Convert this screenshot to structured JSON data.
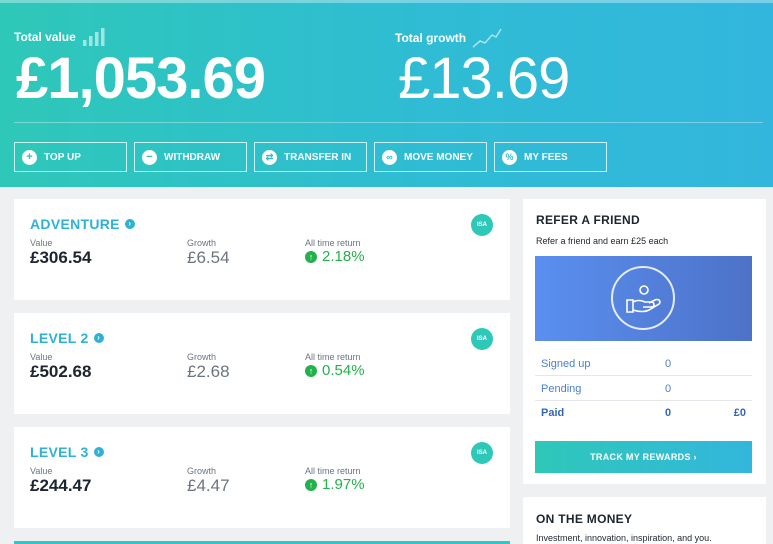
{
  "header": {
    "total_value_label": "Total value",
    "total_value": "£1,053.69",
    "total_growth_label": "Total growth",
    "total_growth": "£13.69",
    "actions": [
      {
        "label": "TOP UP",
        "icon": "plus-icon"
      },
      {
        "label": "WITHDRAW",
        "icon": "minus-icon"
      },
      {
        "label": "TRANSFER IN",
        "icon": "transfer-icon"
      },
      {
        "label": "MOVE MONEY",
        "icon": "link-icon"
      },
      {
        "label": "MY FEES",
        "icon": "percent-icon"
      }
    ]
  },
  "column_labels": {
    "value": "Value",
    "growth": "Growth",
    "return": "All time return"
  },
  "portfolios": [
    {
      "name": "ADVENTURE",
      "value": "£306.54",
      "growth": "£6.54",
      "return": "2.18%",
      "badge": "ISA"
    },
    {
      "name": "LEVEL 2",
      "value": "£502.68",
      "growth": "£2.68",
      "return": "0.54%",
      "badge": "ISA"
    },
    {
      "name": "LEVEL 3",
      "value": "£244.47",
      "growth": "£4.47",
      "return": "1.97%",
      "badge": "ISA"
    }
  ],
  "refer": {
    "title": "REFER A FRIEND",
    "subtitle": "Refer a friend and earn £25 each",
    "rows": [
      {
        "label": "Signed up",
        "count": "0",
        "amount": ""
      },
      {
        "label": "Pending",
        "count": "0",
        "amount": ""
      },
      {
        "label": "Paid",
        "count": "0",
        "amount": "£0"
      }
    ],
    "button": "TRACK MY REWARDS  ›"
  },
  "money": {
    "title": "ON THE MONEY",
    "subtitle": "Investment, innovation, inspiration, and you."
  },
  "colors": {
    "accent": "#2ec8b8",
    "blue": "#2db2d6",
    "positive": "#22b14c"
  }
}
